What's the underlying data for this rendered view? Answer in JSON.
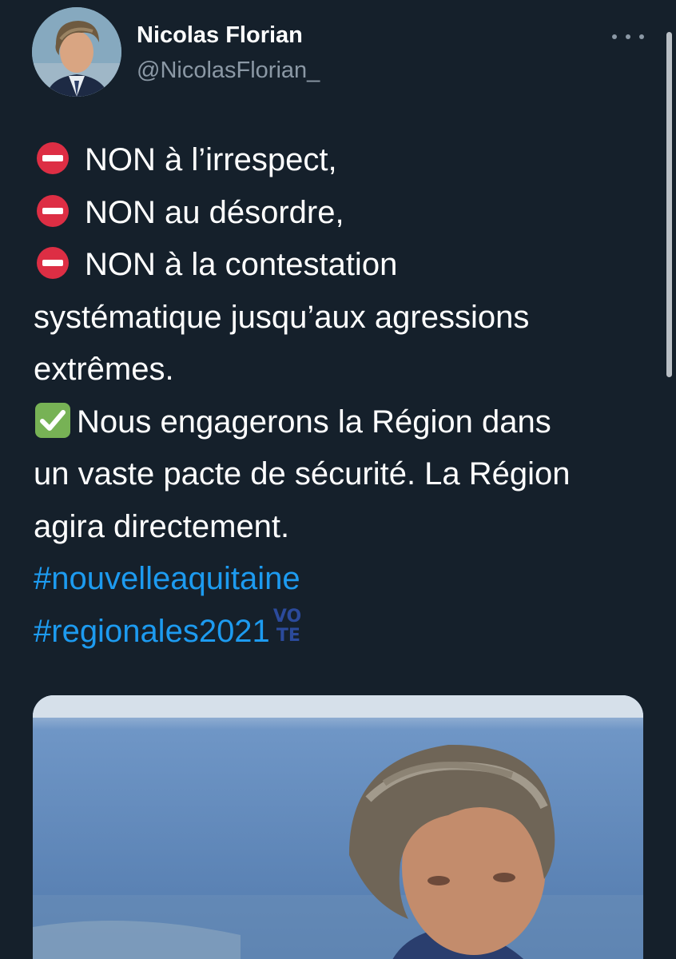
{
  "tweet": {
    "author": {
      "name": "Nicolas Florian",
      "handle": "@NicolasFlorian_"
    },
    "lines": [
      {
        "emoji": "no-entry",
        "text": "NON à l’irrespect,"
      },
      {
        "emoji": "no-entry",
        "text": "NON au désordre,"
      },
      {
        "emoji": "no-entry",
        "text": "NON à la contestation"
      },
      {
        "emoji": "",
        "text": "systématique jusqu’aux agressions"
      },
      {
        "emoji": "",
        "text": "extrêmes."
      },
      {
        "emoji": "check-mark",
        "text": "Nous engagerons la Région dans"
      },
      {
        "emoji": "",
        "text": "un vaste pacte de sécurité. La Région"
      },
      {
        "emoji": "",
        "text": "agira directement."
      }
    ],
    "hashtags": [
      "#nouvelleaquitaine",
      "#regionales2021"
    ],
    "vote_emoji": {
      "top": "VO",
      "bottom": "TE"
    },
    "media": {
      "alt": "photo"
    }
  },
  "colors": {
    "background": "#15202b",
    "text": "#ffffff",
    "secondary": "#8b98a5",
    "link": "#1d9bf0",
    "stop_red": "#dd2e44",
    "check_green": "#77b255",
    "vote_blue": "#2b4a9b",
    "vote_red": "#e0383e"
  },
  "icons": {
    "more": "more-horizontal-icon",
    "no_entry": "no-entry-icon",
    "check": "check-mark-button-icon",
    "vote": "vote-icon"
  }
}
